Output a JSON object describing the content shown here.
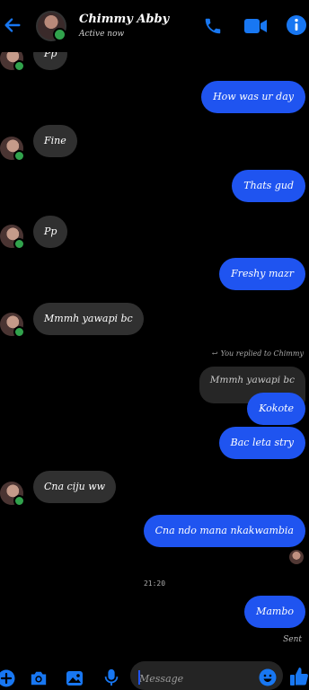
{
  "header": {
    "name": "Chimmy Abby",
    "status": "Active now",
    "icons": [
      "back-arrow-icon",
      "phone-icon",
      "video-camera-icon",
      "info-icon"
    ]
  },
  "messages": [
    {
      "id": "m0",
      "direction": "incoming",
      "text": "Pp",
      "partial": true
    },
    {
      "id": "m1",
      "direction": "outgoing",
      "text": "How was ur day"
    },
    {
      "id": "m2",
      "direction": "incoming",
      "text": "Fine"
    },
    {
      "id": "m3",
      "direction": "outgoing",
      "text": "Thats gud"
    },
    {
      "id": "m4",
      "direction": "incoming",
      "text": "Pp"
    },
    {
      "id": "m5",
      "direction": "outgoing",
      "text": "Freshy mazr"
    },
    {
      "id": "m6",
      "direction": "incoming",
      "text": "Mmmh yawapi bc"
    },
    {
      "id": "m7",
      "direction": "outgoing",
      "reply_label": "You replied to Chimmy",
      "quoted": "Mmmh yawapi bc",
      "text": "Kokote"
    },
    {
      "id": "m8",
      "direction": "outgoing",
      "text": "Bac leta stry"
    },
    {
      "id": "m9",
      "direction": "incoming",
      "text": "Cna ciju ww"
    },
    {
      "id": "m10",
      "direction": "outgoing",
      "text": "Cna ndo mana nkakwambia"
    },
    {
      "id": "m11",
      "direction": "outgoing",
      "text": "Mambo"
    }
  ],
  "timestamp": "21:20",
  "sent_label": "Sent",
  "composer": {
    "placeholder": "Message",
    "icons": [
      "plus-icon",
      "camera-icon",
      "image-icon",
      "microphone-icon",
      "emoji-icon",
      "thumbs-up-icon"
    ]
  },
  "colors": {
    "accent": "#1f54f0",
    "incoming_bubble": "#303030",
    "background": "#000000",
    "online": "#31a24c"
  }
}
